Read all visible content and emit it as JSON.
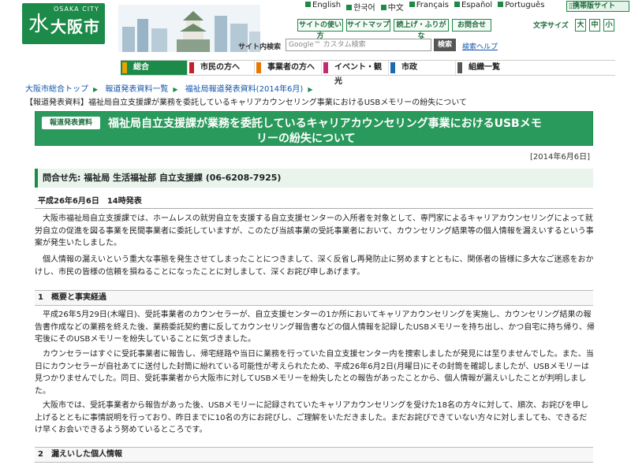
{
  "header": {
    "logo_city": "OSAKA CITY",
    "logo_name": "大阪市",
    "languages": [
      "English",
      "한국어",
      "中文",
      "Français",
      "Español",
      "Português"
    ],
    "mobile_site": "携帯版サイト",
    "tools": [
      "サイトの使い方",
      "サイトマップ",
      "読上げ・ふりがな",
      "お問合せ"
    ],
    "font_size_label": "文字サイズ",
    "font_sizes": [
      "大",
      "中",
      "小"
    ],
    "search_label": "サイト内検索",
    "search_placeholder": "Google™ カスタム検索",
    "search_button": "検索",
    "search_help": "検索ヘルプ"
  },
  "global_nav": {
    "items": [
      {
        "label": "総合",
        "color": "#e8a400"
      },
      {
        "label": "市民の方へ",
        "color": "#c4222a"
      },
      {
        "label": "事業者の方へ",
        "color": "#e87800"
      },
      {
        "label": "イベント・観光",
        "color": "#c42a6e"
      },
      {
        "label": "市政",
        "color": "#1c6bb0"
      },
      {
        "label": "組織一覧",
        "color": "#555555"
      }
    ],
    "accent": "#1c8a48"
  },
  "breadcrumb": [
    "大阪市総合トップ",
    "報道発表資料一覧",
    "福祉局報道発表資料(2014年6月)"
  ],
  "subtitle": "【報道発表資料】福祉局自立支援課が業務を委託しているキャリアカウンセリング事業におけるUSBメモリーの紛失について",
  "article": {
    "badge": "報道発表資料",
    "title_line1": "福祉局自立支援課が業務を委託しているキャリアカウンセリング事業におけるUSBメモ",
    "title_line2": "リーの紛失について",
    "date": "[2014年6月6日]",
    "contact": "問合せ先: 福祉局 生活福祉部 自立支援課 (06-6208-7925)",
    "announce": "平成26年6月6日　14時発表",
    "paragraphs": [
      "大阪市福祉局自立支援課では、ホームレスの就労自立を支援する自立支援センターの入所者を対象として、専門家によるキャリアカウンセリングによって就労自立の促進を図る事業を民間事業者に委託していますが、このたび当該事業の受託事業者において、カウンセリング結果等の個人情報を漏えいするという事案が発生いたしました。",
      "個人情報の漏えいという重大な事態を発生させてしまったことにつきまして、深く反省し再発防止に努めますとともに、関係者の皆様に多大なご迷惑をおかけし、市民の皆様の信頼を損ねることになったことに対しまして、深くお詫び申しあげます。"
    ],
    "section1_title": "1　概要と事実経過",
    "section1_paragraphs": [
      "平成26年5月29日(木曜日)、受託事業者のカウンセラーが、自立支援センターの1か所においてキャリアカウンセリングを実施し、カウンセリング結果の報告書作成などの業務を終えた後、業務委託契約書に反してカウンセリング報告書などの個人情報を記録したUSBメモリーを持ち出し、かつ自宅に持ち帰り、帰宅後にそのUSBメモリーを紛失していることに気づきました。",
      "カウンセラーはすぐに受託事業者に報告し、帰宅経路や当日に業務を行っていた自立支援センター内を捜索しましたが発見には至りませんでした。また、当日にカウンセラーが自社あてに送付した封筒に紛れている可能性が考えられたため、平成26年6月2日(月曜日)にその封筒を確認しましたが、USBメモリーは見つかりませんでした。同日、受託事業者から大阪市に対してUSBメモリーを紛失したとの報告があったことから、個人情報が漏えいしたことが判明しました。",
      "大阪市では、受託事業者から報告があった後、USBメモリーに記録されていたキャリアカウンセリングを受けた18名の方々に対して、順次、お詫びを申し上げるとともに事情説明を行っており、昨日までに10名の方にお詫びし、ご理解をいただきました。まだお詫びできていない方々に対しましても、できるだけ早くお会いできるよう努めているところです。"
    ],
    "section2_title": "2　漏えいした個人情報"
  }
}
